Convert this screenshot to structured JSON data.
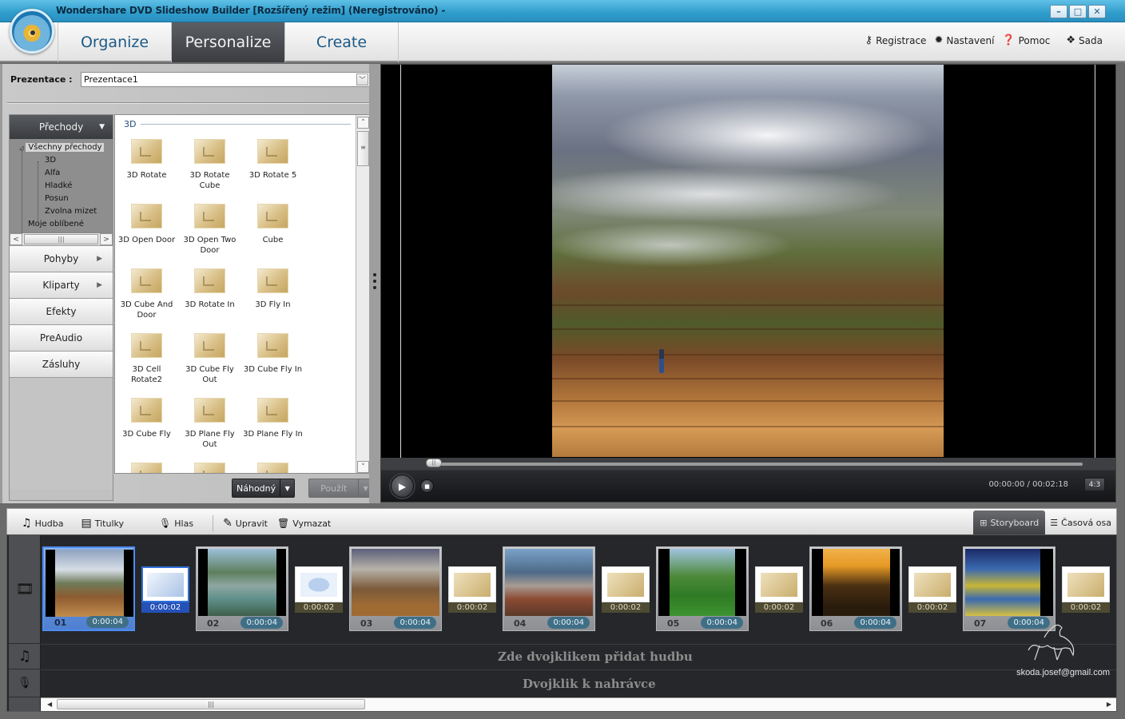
{
  "window": {
    "title": "Wondershare DVD Slideshow Builder [Rozšířený režim] (Neregistrováno) -",
    "controls": {
      "minimize": "–",
      "maximize": "□",
      "close": "✕"
    }
  },
  "nav": {
    "tabs": [
      {
        "label": "Organize",
        "active": false
      },
      {
        "label": "Personalize",
        "active": true
      },
      {
        "label": "Create",
        "active": false
      }
    ],
    "menu": [
      {
        "icon": "key-icon",
        "glyph": "⚷",
        "label": "Registrace"
      },
      {
        "icon": "gear-icon",
        "glyph": "✹",
        "label": "Nastavení"
      },
      {
        "icon": "help-icon",
        "glyph": "❓",
        "label": "Pomoc"
      },
      {
        "icon": "suite-icon",
        "glyph": "❖",
        "label": "Sada"
      }
    ]
  },
  "presentation": {
    "label": "Prezentace :",
    "selected": "Prezentace1"
  },
  "categories": {
    "header": "Přechody",
    "tree": {
      "root": "Všechny přechody",
      "children": [
        "3D",
        "Alfa",
        "Hladké",
        "Posun",
        "Zvolna mizet"
      ],
      "favorites": "Moje oblíbené"
    },
    "buttons": [
      {
        "label": "Pohyby",
        "has_submenu": true
      },
      {
        "label": "Kliparty",
        "has_submenu": true
      },
      {
        "label": "Efekty",
        "has_submenu": false
      },
      {
        "label": "PreAudio",
        "has_submenu": false
      },
      {
        "label": "Zásluhy",
        "has_submenu": false
      }
    ]
  },
  "gallery": {
    "section": "3D",
    "items": [
      "3D Rotate",
      "3D Rotate Cube",
      "3D Rotate 5",
      "3D Open Door",
      "3D Open Two Door",
      "Cube",
      "3D Cube And Door",
      "3D Rotate In",
      "3D Fly In",
      "3D Cell Rotate2",
      "3D Cube Fly Out",
      "3D Cube Fly In",
      "3D Cube Fly",
      "3D Plane Fly Out",
      "3D Plane Fly In"
    ],
    "random_button": "Náhodný",
    "apply_button": "Použít"
  },
  "player": {
    "timecode": "00:00:00 / 00:02:18",
    "aspect_ratio": "4:3",
    "progress": 0.0
  },
  "storyboard_toolbar": {
    "tools": [
      {
        "icon": "music-icon",
        "glyph": "♫",
        "label": "Hudba"
      },
      {
        "icon": "subtitles-icon",
        "glyph": "▤",
        "label": "Titulky"
      },
      {
        "icon": "microphone-icon",
        "glyph": "🎙",
        "label": "Hlas"
      },
      {
        "icon": "pencil-icon",
        "glyph": "✎",
        "label": "Upravit"
      },
      {
        "icon": "trash-icon",
        "glyph": "🗑",
        "label": "Vymazat"
      }
    ],
    "views": [
      {
        "label": "Storyboard",
        "glyph": "⊞",
        "active": true
      },
      {
        "label": "Časová osa",
        "glyph": "☰",
        "active": false
      }
    ]
  },
  "storyboard": {
    "slides": [
      {
        "num": "01",
        "duration": "0:00:04",
        "selected": true
      },
      {
        "num": "02",
        "duration": "0:00:04",
        "selected": false
      },
      {
        "num": "03",
        "duration": "0:00:04",
        "selected": false
      },
      {
        "num": "04",
        "duration": "0:00:04",
        "selected": false
      },
      {
        "num": "05",
        "duration": "0:00:04",
        "selected": false
      },
      {
        "num": "06",
        "duration": "0:00:04",
        "selected": false
      },
      {
        "num": "07",
        "duration": "0:00:04",
        "selected": false
      }
    ],
    "transitions": [
      {
        "duration": "0:00:02",
        "selected": true
      },
      {
        "duration": "0:00:02",
        "selected": false
      },
      {
        "duration": "0:00:02",
        "selected": false
      },
      {
        "duration": "0:00:02",
        "selected": false
      },
      {
        "duration": "0:00:02",
        "selected": false
      },
      {
        "duration": "0:00:02",
        "selected": false
      },
      {
        "duration": "0:00:02",
        "selected": false
      }
    ],
    "music_hint": "Zde dvojklikem přidat hudbu",
    "voice_hint": "Dvojklik k nahrávce",
    "watermark": "skoda.josef@gmail.com"
  }
}
